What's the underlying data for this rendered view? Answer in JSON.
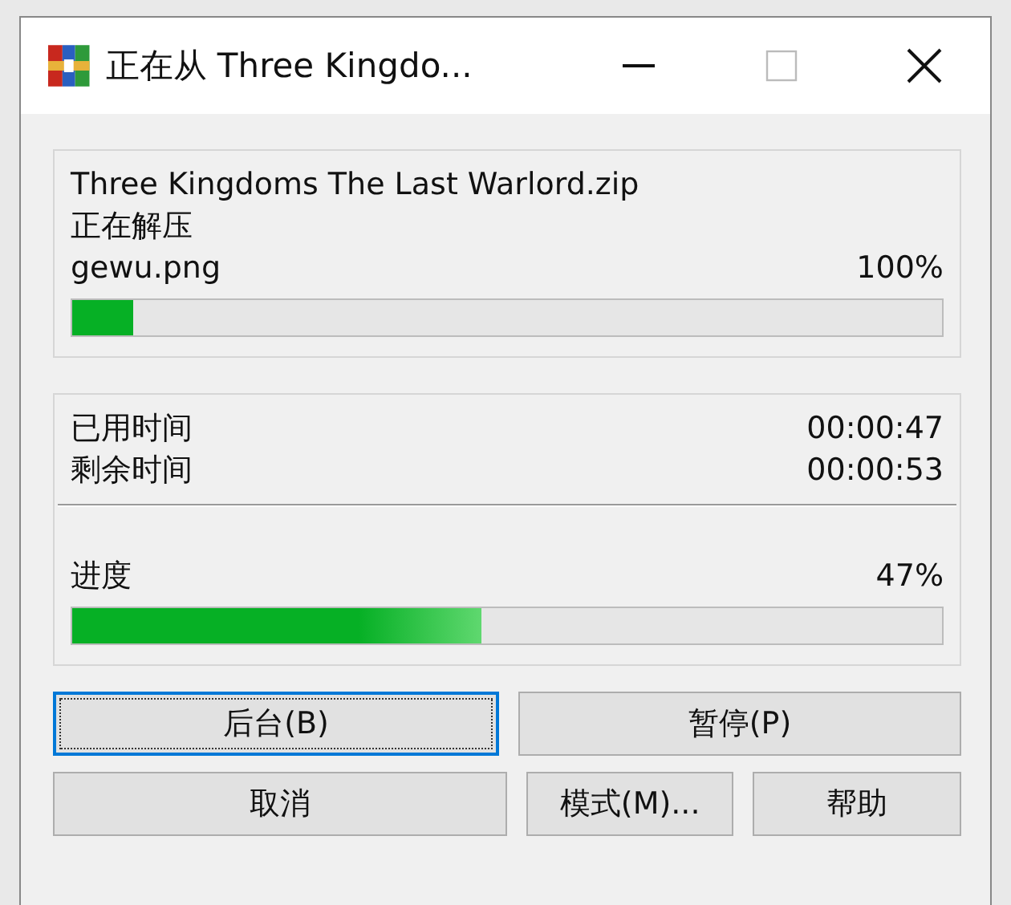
{
  "window": {
    "title": "正在从 Three Kingdo...",
    "maximize_disabled": true
  },
  "current": {
    "archive": "Three Kingdoms The Last Warlord.zip",
    "action": "正在解压",
    "file": "gewu.png",
    "percent": "100%",
    "level": 0.07
  },
  "times": [
    {
      "label": "已用时间",
      "value": "00:00:47"
    },
    {
      "label": "剩余时间",
      "value": "00:00:53"
    }
  ],
  "progress": {
    "label": "进度",
    "percent": "47%",
    "level": 0.47
  },
  "button_rows": [
    [
      {
        "label": "后台(B)",
        "focused": true
      },
      {
        "label": "暂停(P)",
        "focused": false
      }
    ],
    [
      {
        "label": "取消",
        "focused": false
      },
      {
        "label": "模式(M)...",
        "focused": false
      },
      {
        "label": "帮助",
        "focused": false
      }
    ]
  ]
}
